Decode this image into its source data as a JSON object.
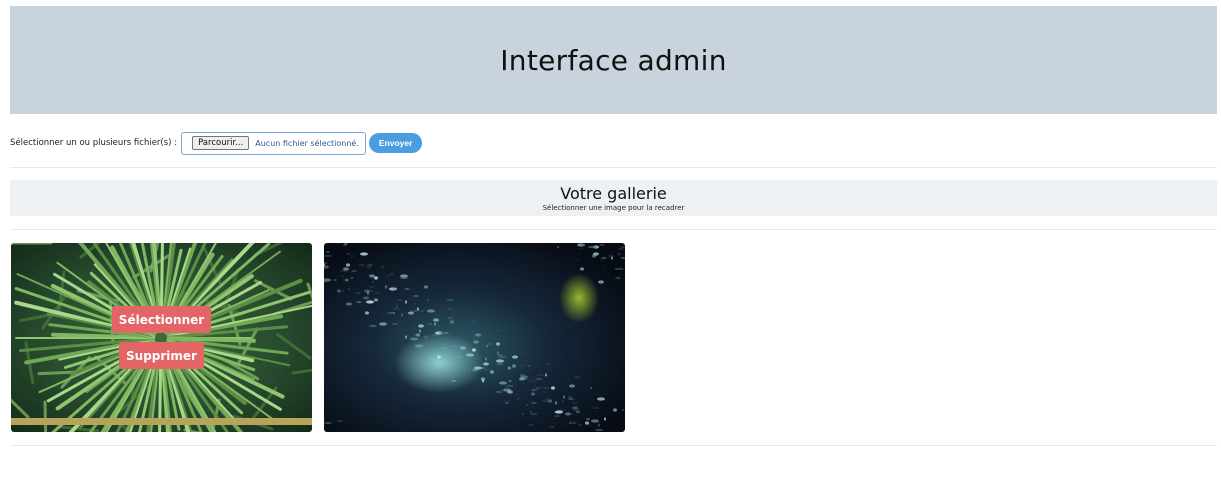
{
  "header": {
    "title": "Interface admin"
  },
  "upload": {
    "label": "Sélectionner un ou plusieurs fichier(s) :",
    "browse_label": "Parcourir...",
    "file_status": "Aucun fichier sélectionné.",
    "send_label": "Envoyer"
  },
  "gallery": {
    "title": "Votre gallerie",
    "subtitle": "Sélectionner une image pour la recadrer",
    "images": [
      {
        "name": "pine-needles",
        "select_label": "Sélectionner",
        "delete_label": "Supprimer"
      },
      {
        "name": "fractal-nebula"
      }
    ]
  },
  "colors": {
    "header_bg": "#c9d3dd",
    "send_button": "#4a9de0",
    "overlay_button": "#e46565",
    "gallery_head_bg": "#eef1f4"
  }
}
